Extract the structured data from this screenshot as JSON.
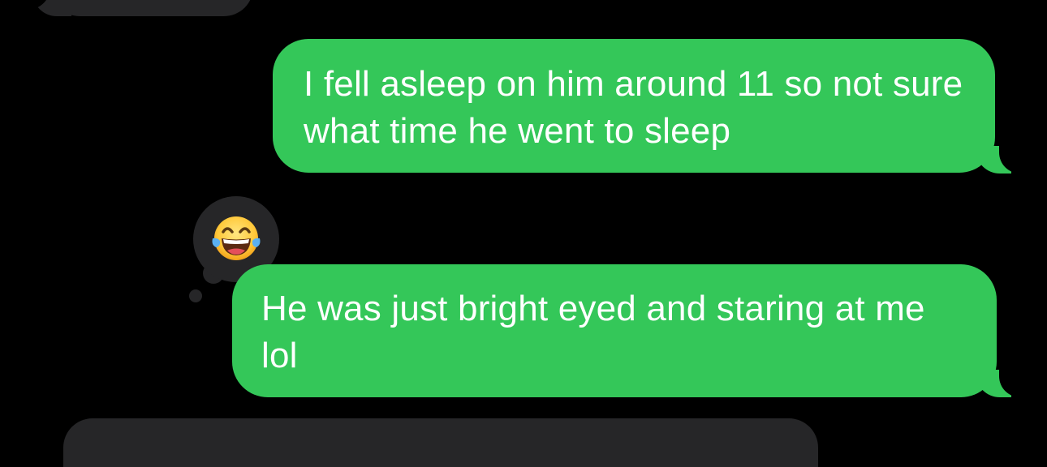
{
  "messages": [
    {
      "direction": "outgoing",
      "text": "I fell asleep on him around 11 so not sure what time he went to sleep"
    },
    {
      "direction": "outgoing",
      "text": "He was just bright eyed and staring at me lol",
      "reaction": {
        "type": "emoji",
        "icon": "face-with-tears-of-joy-icon"
      }
    }
  ],
  "colors": {
    "background": "#000000",
    "outgoing_bubble": "#34C759",
    "incoming_bubble": "#262628",
    "text": "#FFFFFF"
  }
}
